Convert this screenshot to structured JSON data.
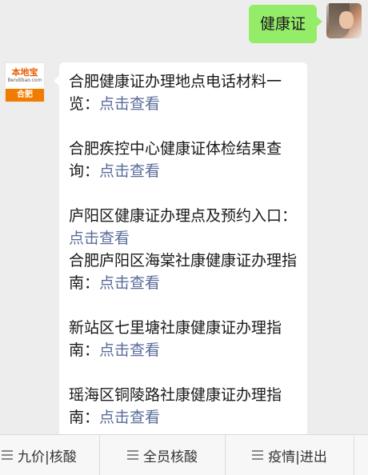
{
  "outgoing": {
    "text": "健康证"
  },
  "incoming": {
    "avatar": {
      "logo": "本地宝",
      "site": "Bendibao.com",
      "city": "合肥"
    },
    "items": [
      {
        "text": "合肥健康证办理地点电话材料一览：",
        "link": "点击查看"
      },
      {
        "text": "合肥疾控中心健康证体检结果查询：",
        "link": "点击查看"
      },
      {
        "text": "庐阳区健康证办理点及预约入口：",
        "link": "点击查看"
      },
      {
        "text": "合肥庐阳区海棠社康健康证办理指南：",
        "link": "点击查看"
      },
      {
        "text": "新站区七里塘社康健康证办理指南：",
        "link": "点击查看"
      },
      {
        "text": "瑶海区铜陵路社康健康证办理指南：",
        "link": "点击查看"
      }
    ]
  },
  "menu": [
    {
      "label": "九价|核酸"
    },
    {
      "label": "全员核酸"
    },
    {
      "label": "疫情|进出"
    }
  ],
  "colors": {
    "outgoing_bubble": "#95ec69",
    "link": "#5a6c9a",
    "background": "#ededed"
  }
}
